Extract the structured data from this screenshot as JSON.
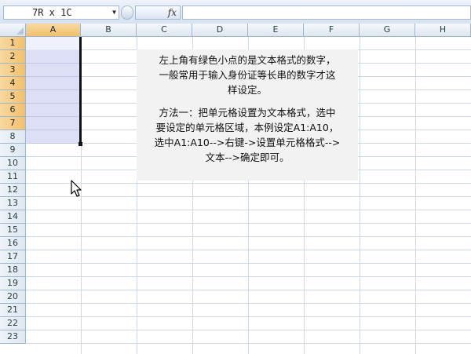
{
  "formula_bar": {
    "name_box_value": "7R x 1C",
    "fx_label": "fx",
    "formula_value": ""
  },
  "columns": [
    {
      "label": "A",
      "selected": true
    },
    {
      "label": "B",
      "selected": false
    },
    {
      "label": "C",
      "selected": false
    },
    {
      "label": "D",
      "selected": false
    },
    {
      "label": "E",
      "selected": false
    },
    {
      "label": "F",
      "selected": false
    },
    {
      "label": "G",
      "selected": false
    },
    {
      "label": "H",
      "selected": false
    }
  ],
  "rows": [
    {
      "label": "1",
      "selected": true
    },
    {
      "label": "2",
      "selected": true
    },
    {
      "label": "3",
      "selected": true
    },
    {
      "label": "4",
      "selected": true
    },
    {
      "label": "5",
      "selected": true
    },
    {
      "label": "6",
      "selected": true
    },
    {
      "label": "7",
      "selected": true
    },
    {
      "label": "8",
      "selected": false
    },
    {
      "label": "9",
      "selected": false
    },
    {
      "label": "10",
      "selected": false
    },
    {
      "label": "11",
      "selected": false
    },
    {
      "label": "12",
      "selected": false
    },
    {
      "label": "13",
      "selected": false
    },
    {
      "label": "14",
      "selected": false
    },
    {
      "label": "15",
      "selected": false
    },
    {
      "label": "16",
      "selected": false
    },
    {
      "label": "17",
      "selected": false
    },
    {
      "label": "18",
      "selected": false
    },
    {
      "label": "19",
      "selected": false
    },
    {
      "label": "20",
      "selected": false
    },
    {
      "label": "21",
      "selected": false
    },
    {
      "label": "22",
      "selected": false
    },
    {
      "label": "23",
      "selected": false
    }
  ],
  "text_box": {
    "paragraph_1": "左上角有绿色小点的是文本格式的数字，\n一般常用于输入身份证等长串的数字才这\n样设定。",
    "paragraph_2": "方法一：把单元格设置为文本格式，选中\n要设定的单元格区域，本例设定A1:A10，\n选中A1:A10-->右键->设置单元格格式-->\n文本-->确定即可。"
  },
  "colors": {
    "header_selected": "#f1c06b",
    "selection_fill": "#abb2e6",
    "gridline": "#d0d7e5",
    "text_box_bg": "#f2f2f2"
  },
  "icons": {
    "name_box_dropdown": "chevron-down-icon",
    "mouse_pointer": "mouse-pointer-icon"
  }
}
